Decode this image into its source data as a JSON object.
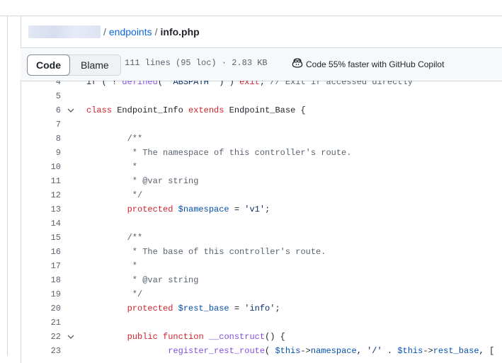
{
  "breadcrumb": {
    "folder": "endpoints",
    "file": "info.php",
    "sep1": "/",
    "sep2": "/"
  },
  "toolbar": {
    "tab_code": "Code",
    "tab_blame": "Blame",
    "file_meta": "111 lines (95 loc) · 2.83 KB",
    "copilot_label": "Code 55% faster with GitHub Copilot"
  },
  "colors": {
    "link": "#0969da",
    "keyword": "#cf222e",
    "comment": "#59636e",
    "variable": "#0550ae",
    "string": "#0a3069",
    "function": "#8250df"
  },
  "code": {
    "lines": [
      {
        "n": "4",
        "fold": false,
        "tokens": [
          [
            "pl",
            "if ( ! "
          ],
          [
            "fn",
            "defined"
          ],
          [
            "pl",
            "( "
          ],
          [
            "str",
            "'ABSPATH'"
          ],
          [
            "pl",
            " ) ) "
          ],
          [
            "kw",
            "exit"
          ],
          [
            "pl",
            "; "
          ],
          [
            "cm",
            "// Exit if accessed directly"
          ]
        ]
      },
      {
        "n": "5",
        "fold": false,
        "tokens": []
      },
      {
        "n": "6",
        "fold": true,
        "tokens": [
          [
            "kw",
            "class"
          ],
          [
            "pl",
            " Endpoint_Info "
          ],
          [
            "kw",
            "extends"
          ],
          [
            "pl",
            " Endpoint_Base {"
          ]
        ]
      },
      {
        "n": "7",
        "fold": false,
        "tokens": []
      },
      {
        "n": "8",
        "fold": false,
        "tokens": [
          [
            "pl",
            "        "
          ],
          [
            "cm",
            "/**"
          ]
        ]
      },
      {
        "n": "9",
        "fold": false,
        "tokens": [
          [
            "pl",
            "        "
          ],
          [
            "cm",
            " * The namespace of this controller's route."
          ]
        ]
      },
      {
        "n": "10",
        "fold": false,
        "tokens": [
          [
            "pl",
            "        "
          ],
          [
            "cm",
            " *"
          ]
        ]
      },
      {
        "n": "11",
        "fold": false,
        "tokens": [
          [
            "pl",
            "        "
          ],
          [
            "cm",
            " * @var string"
          ]
        ]
      },
      {
        "n": "12",
        "fold": false,
        "tokens": [
          [
            "pl",
            "        "
          ],
          [
            "cm",
            " */"
          ]
        ]
      },
      {
        "n": "13",
        "fold": false,
        "tokens": [
          [
            "pl",
            "        "
          ],
          [
            "kw",
            "protected"
          ],
          [
            "pl",
            " "
          ],
          [
            "var",
            "$namespace"
          ],
          [
            "pl",
            " = "
          ],
          [
            "str",
            "'v1'"
          ],
          [
            "pl",
            ";"
          ]
        ]
      },
      {
        "n": "14",
        "fold": false,
        "tokens": []
      },
      {
        "n": "15",
        "fold": false,
        "tokens": [
          [
            "pl",
            "        "
          ],
          [
            "cm",
            "/**"
          ]
        ]
      },
      {
        "n": "16",
        "fold": false,
        "tokens": [
          [
            "pl",
            "        "
          ],
          [
            "cm",
            " * The base of this controller's route."
          ]
        ]
      },
      {
        "n": "17",
        "fold": false,
        "tokens": [
          [
            "pl",
            "        "
          ],
          [
            "cm",
            " *"
          ]
        ]
      },
      {
        "n": "18",
        "fold": false,
        "tokens": [
          [
            "pl",
            "        "
          ],
          [
            "cm",
            " * @var string"
          ]
        ]
      },
      {
        "n": "19",
        "fold": false,
        "tokens": [
          [
            "pl",
            "        "
          ],
          [
            "cm",
            " */"
          ]
        ]
      },
      {
        "n": "20",
        "fold": false,
        "tokens": [
          [
            "pl",
            "        "
          ],
          [
            "kw",
            "protected"
          ],
          [
            "pl",
            " "
          ],
          [
            "var",
            "$rest_base"
          ],
          [
            "pl",
            " = "
          ],
          [
            "str",
            "'info'"
          ],
          [
            "pl",
            ";"
          ]
        ]
      },
      {
        "n": "21",
        "fold": false,
        "tokens": []
      },
      {
        "n": "22",
        "fold": true,
        "tokens": [
          [
            "pl",
            "        "
          ],
          [
            "kw",
            "public"
          ],
          [
            "pl",
            " "
          ],
          [
            "kw",
            "function"
          ],
          [
            "pl",
            " "
          ],
          [
            "fn",
            "__construct"
          ],
          [
            "pl",
            "() {"
          ]
        ]
      },
      {
        "n": "23",
        "fold": false,
        "tokens": [
          [
            "pl",
            "                "
          ],
          [
            "fn",
            "register_rest_route"
          ],
          [
            "pl",
            "( "
          ],
          [
            "var",
            "$this"
          ],
          [
            "pl",
            "->"
          ],
          [
            "var",
            "namespace"
          ],
          [
            "pl",
            ", "
          ],
          [
            "str",
            "'/'"
          ],
          [
            "pl",
            " . "
          ],
          [
            "var",
            "$this"
          ],
          [
            "pl",
            "->"
          ],
          [
            "var",
            "rest_base"
          ],
          [
            "pl",
            ", ["
          ]
        ]
      }
    ]
  }
}
